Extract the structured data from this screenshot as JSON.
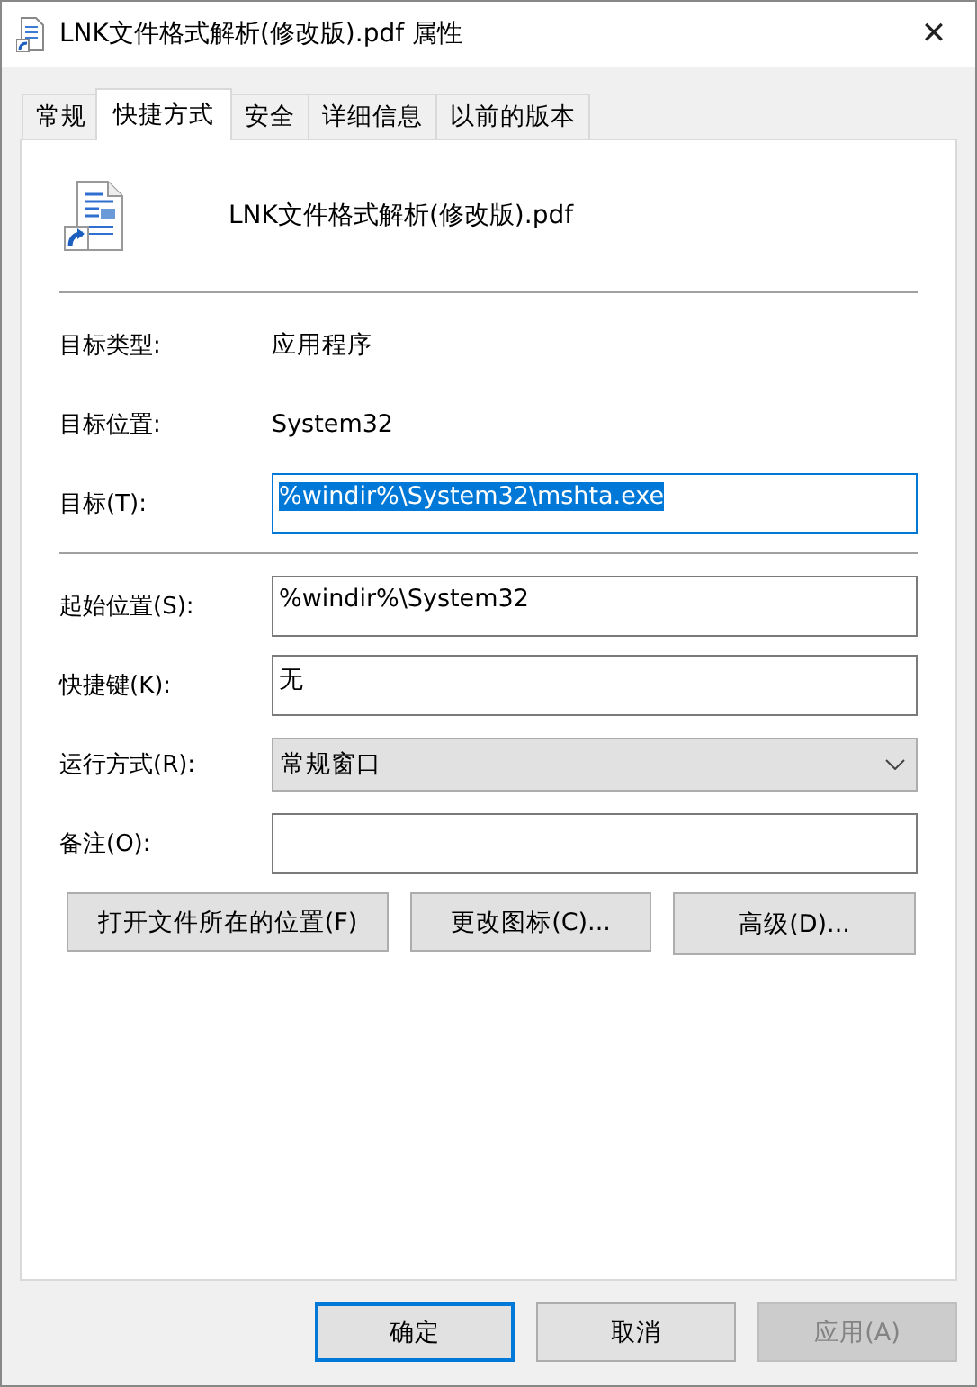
{
  "window": {
    "title": "LNK文件格式解析(修改版).pdf 属性",
    "close": "✕"
  },
  "tabs": [
    {
      "label": "常规",
      "selected": false
    },
    {
      "label": "快捷方式",
      "selected": true
    },
    {
      "label": "安全",
      "selected": false
    },
    {
      "label": "详细信息",
      "selected": false
    },
    {
      "label": "以前的版本",
      "selected": false
    }
  ],
  "file_name": "LNK文件格式解析(修改版).pdf",
  "info": [
    {
      "label": "目标类型:",
      "value": "应用程序"
    },
    {
      "label": "目标位置:",
      "value": "System32"
    }
  ],
  "target": {
    "label": "目标(T):",
    "value": "%windir%\\System32\\mshta.exe",
    "highlighted": true
  },
  "fields": [
    {
      "kind": "text",
      "label": "起始位置(S):",
      "value": "%windir%\\System32"
    },
    {
      "kind": "text",
      "label": "快捷键(K):",
      "value": "无"
    },
    {
      "kind": "select",
      "label": "运行方式(R):",
      "value": "常规窗口"
    },
    {
      "kind": "text",
      "label": "备注(O):"
    }
  ],
  "actions": [
    "打开文件所在的位置(F)",
    "更改图标(C)...",
    "高级(D)..."
  ],
  "buttons": [
    {
      "label": "确定",
      "default": true,
      "disabled": false
    },
    {
      "label": "取消",
      "default": false,
      "disabled": false
    },
    {
      "label": "应用(A)",
      "default": false,
      "disabled": true
    }
  ]
}
